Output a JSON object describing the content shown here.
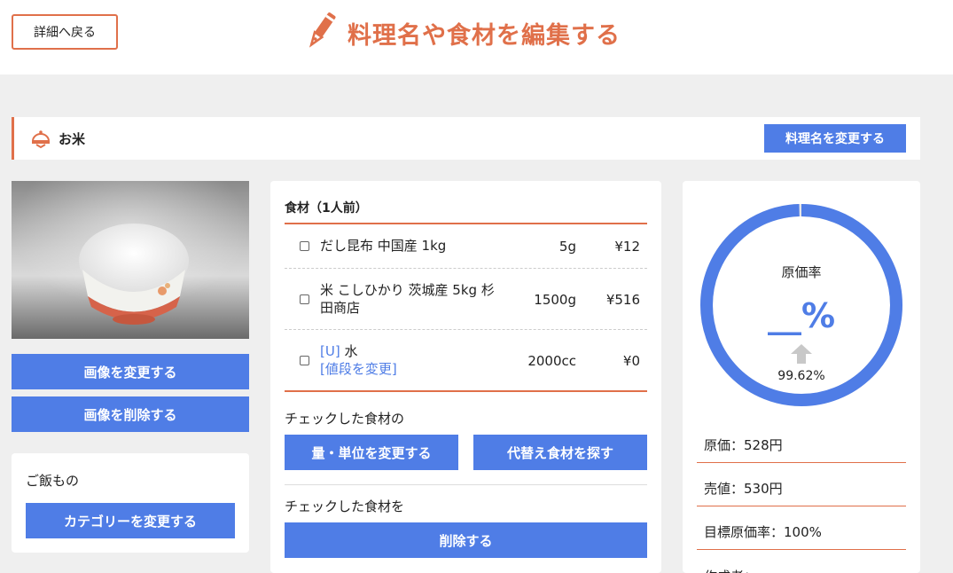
{
  "header": {
    "back_label": "詳細へ戻る",
    "title": "料理名や食材を編集する"
  },
  "dish": {
    "name": "お米",
    "rename_label": "料理名を変更する"
  },
  "photo_actions": {
    "change_label": "画像を変更する",
    "delete_label": "画像を削除する"
  },
  "category": {
    "name": "ご飯もの",
    "change_label": "カテゴリーを変更する"
  },
  "ingredients": {
    "heading": "食材（1人前）",
    "rows": [
      {
        "tag": "",
        "name": "だし昆布 中国産 1kg",
        "link": "",
        "qty": "5g",
        "price": "¥12"
      },
      {
        "tag": "",
        "name": "米 こしひかり 茨城産 5kg 杉田商店",
        "link": "",
        "qty": "1500g",
        "price": "¥516"
      },
      {
        "tag": "[U]",
        "name": " 水",
        "link": "[値段を変更]",
        "qty": "2000cc",
        "price": "¥0"
      }
    ],
    "checked_of_label": "チェックした食材の",
    "change_qty_label": "量・単位を変更する",
    "find_sub_label": "代替え食材を探す",
    "checked_label": "チェックした食材を",
    "delete_label": "削除する"
  },
  "cost": {
    "rate_label": "原価率",
    "rate_value": "__%",
    "target_rate_value": "99.62%",
    "cost_text": "原価：528円",
    "price_text": "売値：530円",
    "target_text": "目標原価率：100%",
    "author_text": "作成者：",
    "donut_fraction": 0.996,
    "accent_color": "#4f7de6"
  },
  "colors": {
    "accent_orange": "#e0704a",
    "primary_blue": "#4f7de6",
    "background": "#efefef"
  },
  "icons": {
    "title_icon": "pen-icon",
    "dish_icon": "cloche-icon",
    "up_arrow": "arrow-up-icon"
  }
}
